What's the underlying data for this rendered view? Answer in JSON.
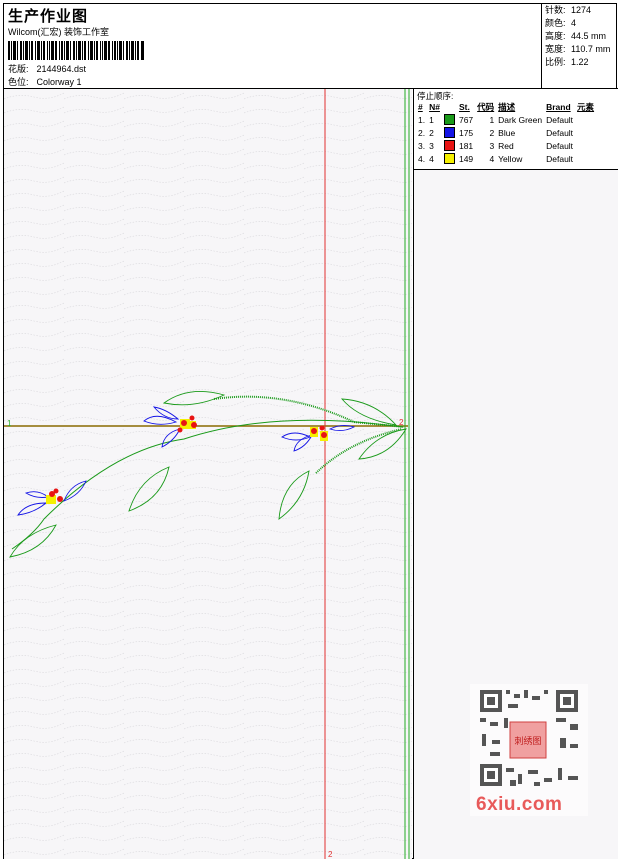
{
  "header": {
    "title": "生产作业图",
    "subtitle": "Wilcom(汇宏) 装饰工作室",
    "design_label": "花版:",
    "design_value": "2144964.dst",
    "colorway_label": "色位:",
    "colorway_value": "Colorway 1"
  },
  "stats": {
    "stitches_label": "针数:",
    "stitches_value": "1274",
    "colors_label": "颜色:",
    "colors_value": "4",
    "height_label": "高度:",
    "height_value": "44.5 mm",
    "width_label": "宽度:",
    "width_value": "110.7 mm",
    "scale_label": "比例:",
    "scale_value": "1.22"
  },
  "legend": {
    "caption": "停止顺序:",
    "headers": [
      "#",
      "N#",
      "St.",
      "代码",
      "描述",
      "Brand",
      "元素"
    ],
    "rows": [
      {
        "idx": "1.",
        "n": "1",
        "color": "#1a9a1a",
        "st": "767",
        "code": "1",
        "desc": "Dark Green",
        "brand": "Default"
      },
      {
        "idx": "2.",
        "n": "2",
        "color": "#1414e6",
        "st": "175",
        "code": "2",
        "desc": "Blue",
        "brand": "Default"
      },
      {
        "idx": "3.",
        "n": "3",
        "color": "#e81414",
        "st": "181",
        "code": "3",
        "desc": "Red",
        "brand": "Default"
      },
      {
        "idx": "4.",
        "n": "4",
        "color": "#f5f000",
        "st": "149",
        "code": "4",
        "desc": "Yellow",
        "brand": "Default"
      }
    ]
  },
  "canvas": {
    "marker_start": "1",
    "marker_end_h": "2",
    "marker_end_v": "2"
  },
  "watermark": {
    "text": "6xiu.com",
    "stamp": "刺绣图"
  }
}
